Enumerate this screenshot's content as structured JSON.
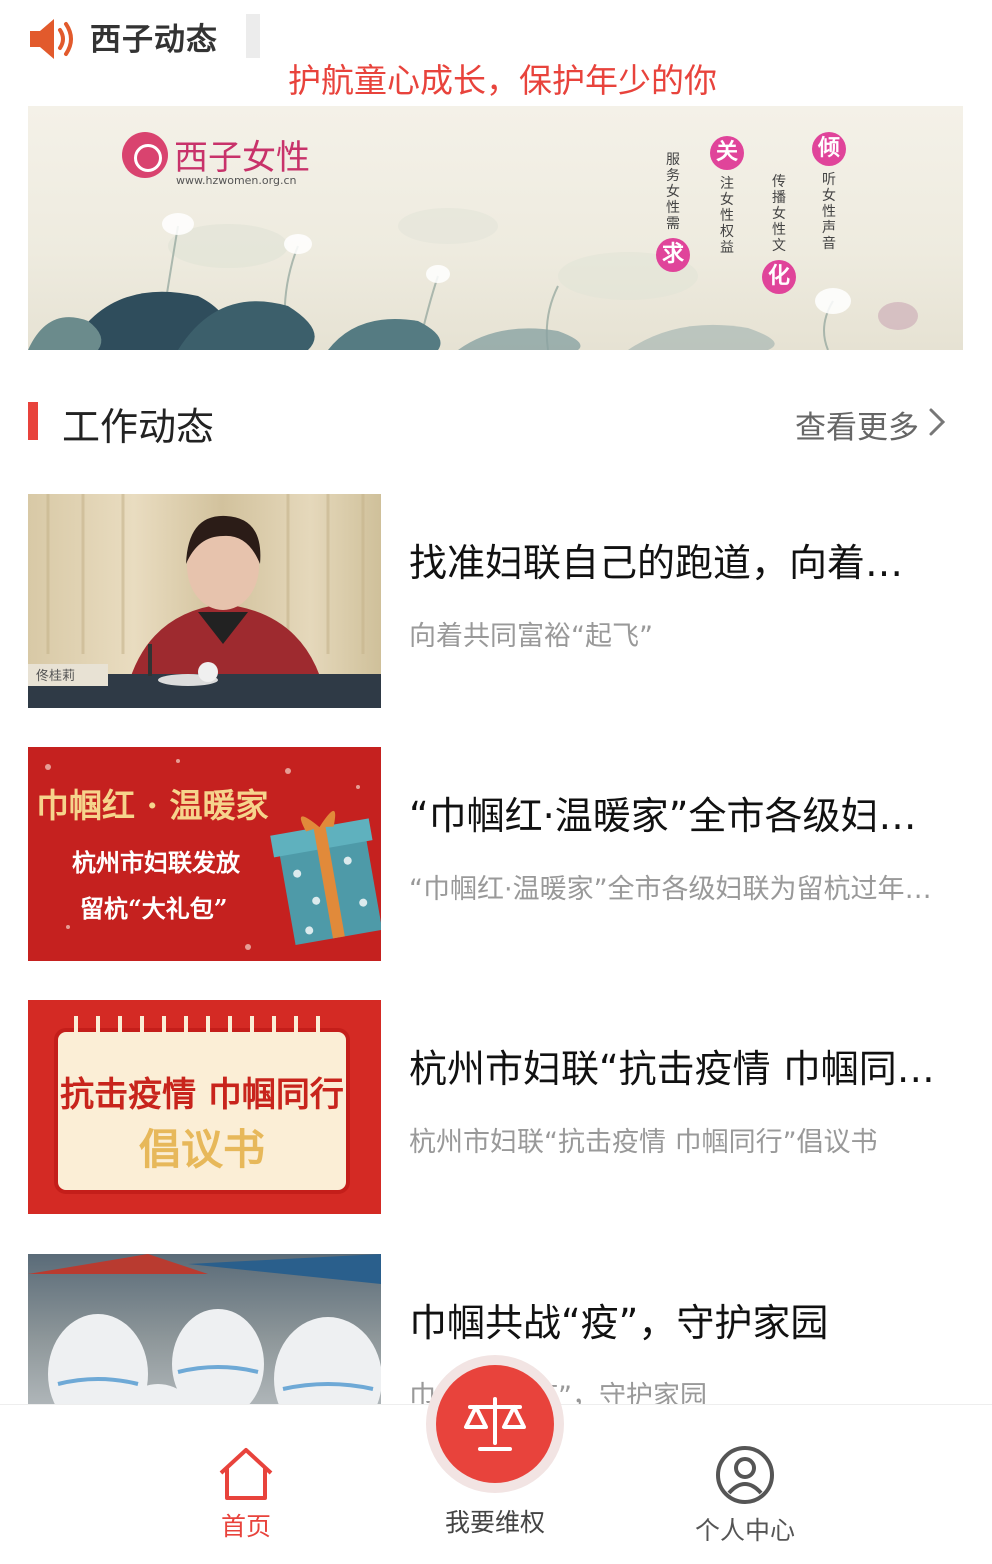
{
  "ticker": {
    "brand": "西子动态",
    "headline": "护航童心成长，保护年少的你",
    "icon": "speaker-icon"
  },
  "banner": {
    "logo_text": "西子女性",
    "logo_url": "www.hzwomen.org.cn",
    "slogans": [
      {
        "circle": "倾",
        "text": "听女性声音"
      },
      {
        "circle": "化",
        "text": "传播女性文"
      },
      {
        "circle": "关",
        "text": "注女性权益"
      },
      {
        "circle": "求",
        "text": "服务女性需"
      }
    ]
  },
  "section": {
    "title": "工作动态",
    "more": "查看更多"
  },
  "news": [
    {
      "title": "找准妇联自己的跑道，向着共同富裕“起飞”",
      "summary": "向着共同富裕“起飞”",
      "thumb": {
        "caption": "佟桂莉"
      }
    },
    {
      "title": "“巾帼红·温暖家”全市各级妇联为留杭过年的她们送温暖",
      "summary": "“巾帼红·温暖家”全市各级妇联为留杭过年的她们送温暖",
      "thumb": {
        "line1": "巾帼红 · 温暖家",
        "line2": "杭州市妇联发放",
        "line3": "留杭“大礼包”"
      }
    },
    {
      "title": "杭州市妇联“抗击疫情 巾帼同行”倡议书",
      "summary": "杭州市妇联“抗击疫情 巾帼同行”倡议书",
      "thumb": {
        "line1": "抗击疫情 巾帼同行",
        "line2": "倡议书"
      }
    },
    {
      "title": "巾帼共战“疫”，守护家园",
      "summary": "巾帼共战“疫”，守护家园",
      "thumb": {}
    }
  ],
  "tabbar": {
    "home": "首页",
    "rights": "我要维权",
    "profile": "个人中心"
  },
  "colors": {
    "accent": "#e8433c",
    "pink": "#e0449a",
    "muted": "#999999"
  }
}
